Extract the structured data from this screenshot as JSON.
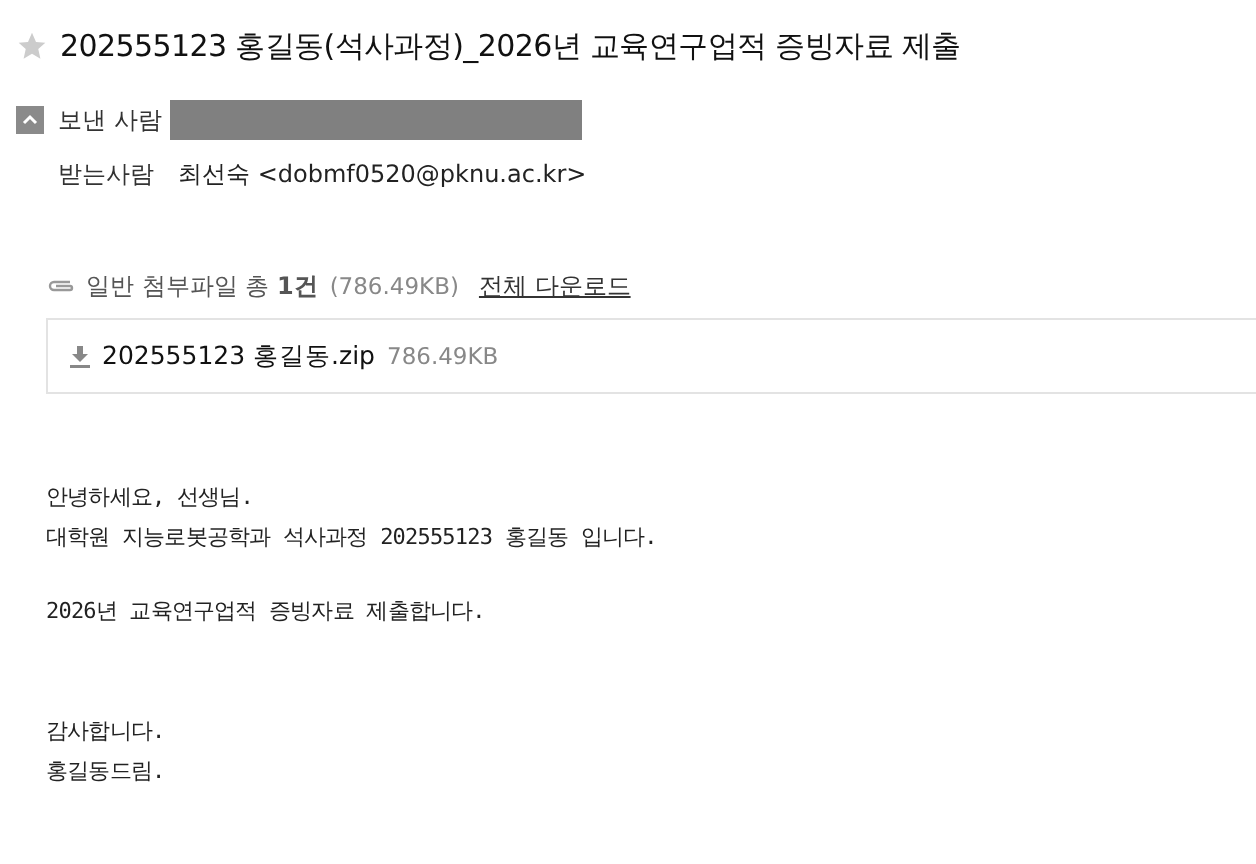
{
  "subject": {
    "starred": false,
    "text": "202555123 홍길동(석사과정)_2026년 교육연구업적 증빙자료 제출"
  },
  "sender": {
    "label": "보낸 사람",
    "expanded": true,
    "redacted": true
  },
  "recipient": {
    "label": "받는사람",
    "value": "최선숙 <dobmf0520@pknu.ac.kr>"
  },
  "attachments": {
    "summary": "일반 첨부파일 총 **1건**",
    "size": "(786.49KB)",
    "download_all": "전체 다운로드",
    "files": [
      {
        "name": "202555123 홍길동.zip",
        "size": "786.49KB"
      }
    ]
  },
  "body": [
    {
      "kind": "normal",
      "lines": [
        "안녕하세요, 선생님.",
        "대학원 지능로봇공학과 석사과정 202555123 홍길동 입니다."
      ]
    },
    {
      "kind": "normal",
      "lines": [
        "2026년 교육연구업적 증빙자료 제출합니다."
      ]
    },
    {
      "kind": "closing",
      "lines": [
        "감사합니다.",
        "홍길동드림."
      ]
    }
  ]
}
